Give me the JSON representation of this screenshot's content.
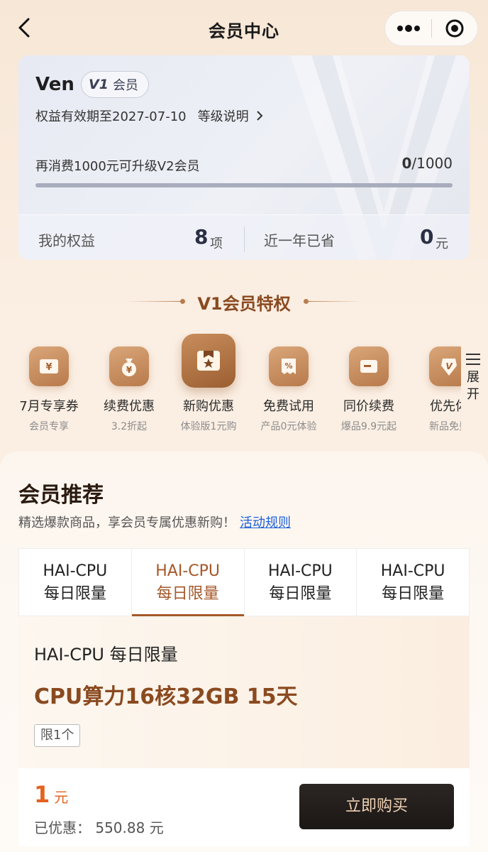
{
  "nav": {
    "title": "会员中心"
  },
  "member": {
    "name": "Ven",
    "level_badge": "V1",
    "level_text": "会员",
    "validity": "权益有效期至2027-07-10",
    "level_desc": "等级说明",
    "upgrade_text": "再消费1000元可升级V2会员",
    "progress_current": "0",
    "progress_total": "/1000",
    "progress_fraction": 0,
    "benefits_label": "我的权益",
    "benefits_value": "8",
    "benefits_unit": "项",
    "saved_label": "近一年已省",
    "saved_value": "0",
    "saved_unit": "元"
  },
  "privileges": {
    "title": "V1会员特权",
    "items": [
      {
        "name": "7月专享券",
        "sub": "会员专享",
        "icon": "ticket-yen-icon"
      },
      {
        "name": "续费优惠",
        "sub": "3.2折起",
        "icon": "money-bag-icon"
      },
      {
        "name": "新购优惠",
        "sub": "体验版1元购",
        "icon": "gift-box-icon"
      },
      {
        "name": "免费试用",
        "sub": "产品0元体验",
        "icon": "discount-coupon-icon"
      },
      {
        "name": "同价续费",
        "sub": "爆品9.9元起",
        "icon": "card-icon"
      },
      {
        "name": "优先体",
        "sub": "新品免费",
        "icon": "v-badge-icon"
      }
    ],
    "expand_label_1": "展",
    "expand_label_2": "开"
  },
  "recommend": {
    "title": "会员推荐",
    "desc": "精选爆款商品，享会员专属优惠新购！",
    "rules_link": "活动规则",
    "tabs": [
      {
        "line1": "HAI-CPU",
        "line2": "每日限量"
      },
      {
        "line1": "HAI-CPU",
        "line2": "每日限量"
      },
      {
        "line1": "HAI-CPU",
        "line2": "每日限量"
      },
      {
        "line1": "HAI-CPU",
        "line2": "每日限量"
      }
    ],
    "active_tab": 1,
    "product": {
      "title": "HAI-CPU 每日限量",
      "spec": "CPU算力16核32GB 15天",
      "limit": "限1个"
    },
    "price_value": "1",
    "price_unit": "元",
    "saved": "已优惠： 550.88 元",
    "buy_label": "立即购买"
  },
  "colors": {
    "accent_brown": "#8a4a20",
    "tab_active": "#a5582a",
    "price": "#e4621f",
    "link": "#1e5fd8",
    "buy_button": "#1b1715"
  }
}
